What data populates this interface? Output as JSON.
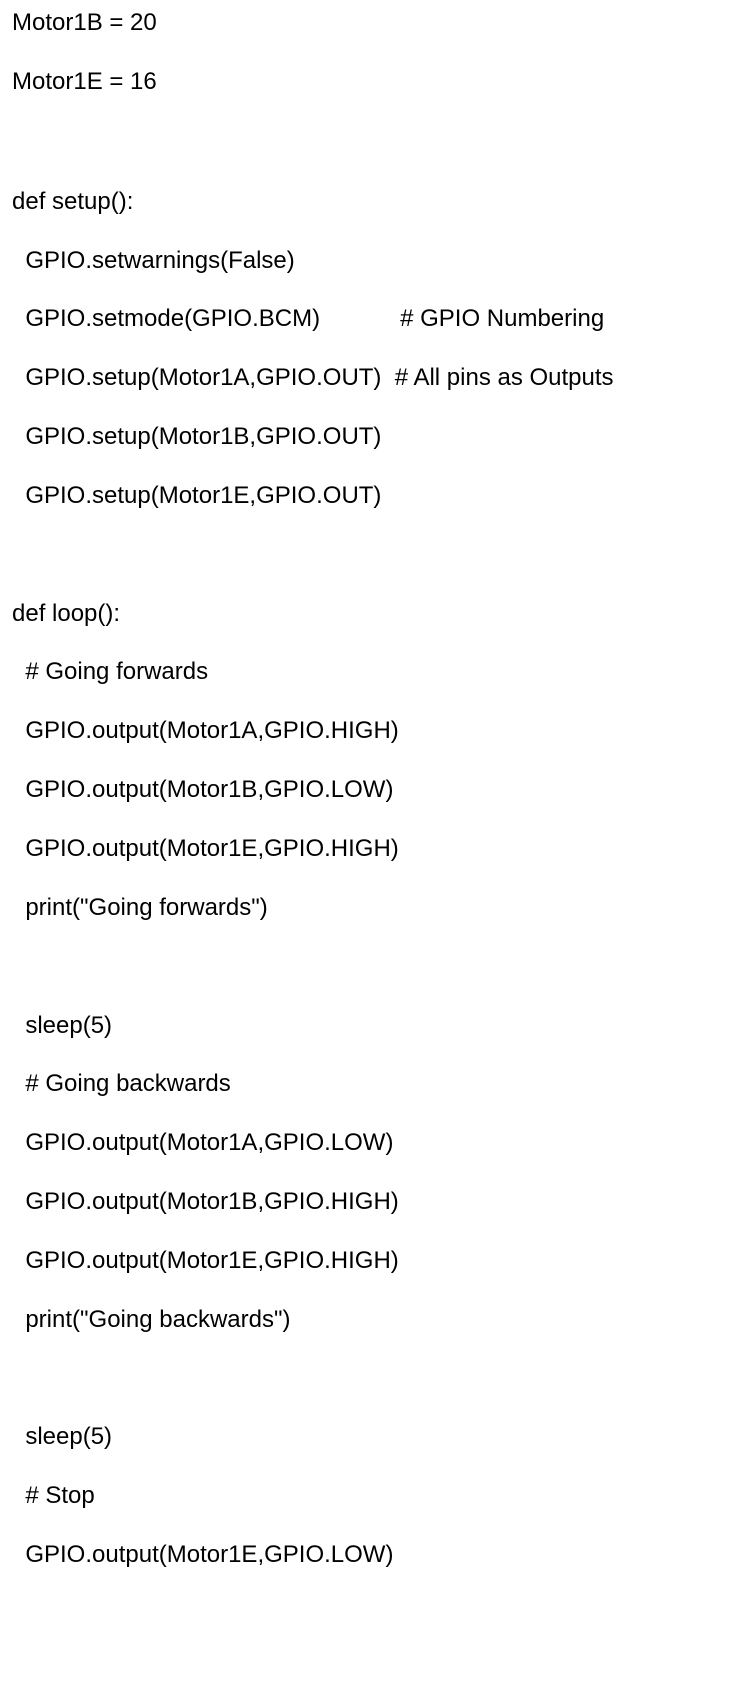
{
  "document": {
    "lines": [
      "Motor1B = 20",
      "Motor1E = 16",
      "",
      "def setup():",
      "  GPIO.setwarnings(False)",
      "  GPIO.setmode(GPIO.BCM)            # GPIO Numbering",
      "  GPIO.setup(Motor1A,GPIO.OUT)  # All pins as Outputs",
      "  GPIO.setup(Motor1B,GPIO.OUT)",
      "  GPIO.setup(Motor1E,GPIO.OUT)",
      "",
      "def loop():",
      "  # Going forwards",
      "  GPIO.output(Motor1A,GPIO.HIGH)",
      "  GPIO.output(Motor1B,GPIO.LOW)",
      "  GPIO.output(Motor1E,GPIO.HIGH)",
      "  print(\"Going forwards\")",
      "",
      "  sleep(5)",
      "  # Going backwards",
      "  GPIO.output(Motor1A,GPIO.LOW)",
      "  GPIO.output(Motor1B,GPIO.HIGH)",
      "  GPIO.output(Motor1E,GPIO.HIGH)",
      "  print(\"Going backwards\")",
      "",
      "  sleep(5)",
      "  # Stop",
      "  GPIO.output(Motor1E,GPIO.LOW)"
    ]
  }
}
